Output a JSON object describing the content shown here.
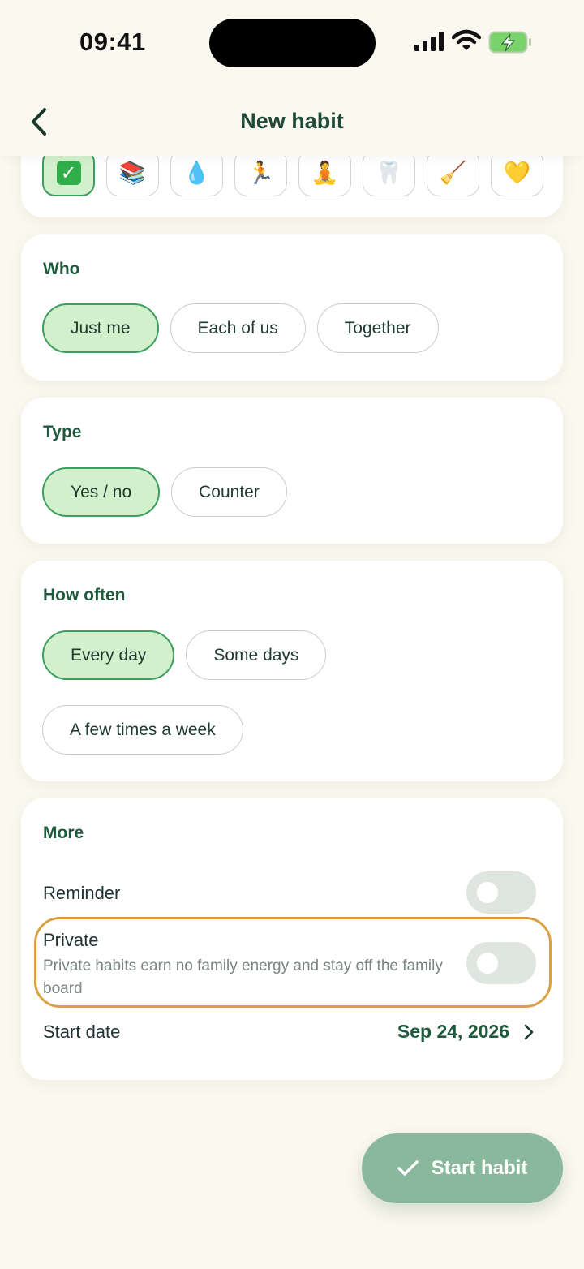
{
  "status_bar": {
    "time": "09:41"
  },
  "header": {
    "title": "New habit"
  },
  "icons": {
    "items": [
      "✅",
      "📚",
      "💧",
      "🏃",
      "🧘",
      "🦷",
      "🧹",
      "💛"
    ],
    "selected_index": 0
  },
  "who": {
    "title": "Who",
    "options": [
      "Just me",
      "Each of us",
      "Together"
    ],
    "selected": "Just me"
  },
  "type": {
    "title": "Type",
    "options": [
      "Yes / no",
      "Counter"
    ],
    "selected": "Yes / no"
  },
  "frequency": {
    "title": "How often",
    "options": [
      "Every day",
      "Some days",
      "A few times a week"
    ],
    "selected": "Every day"
  },
  "more": {
    "title": "More",
    "reminder": {
      "label": "Reminder",
      "on": false
    },
    "private": {
      "label": "Private",
      "helper": "Private habits earn no family energy and stay off the family board",
      "on": false
    },
    "start_date": {
      "label": "Start date",
      "value": "Sep 24, 2026"
    }
  },
  "fab": {
    "label": "Start habit"
  },
  "colors": {
    "background": "#faf8ef",
    "accent": "#1f5a3c",
    "selected_fill": "#d3f0cc",
    "highlight": "#d9a143",
    "fab": "#8ab89c"
  }
}
